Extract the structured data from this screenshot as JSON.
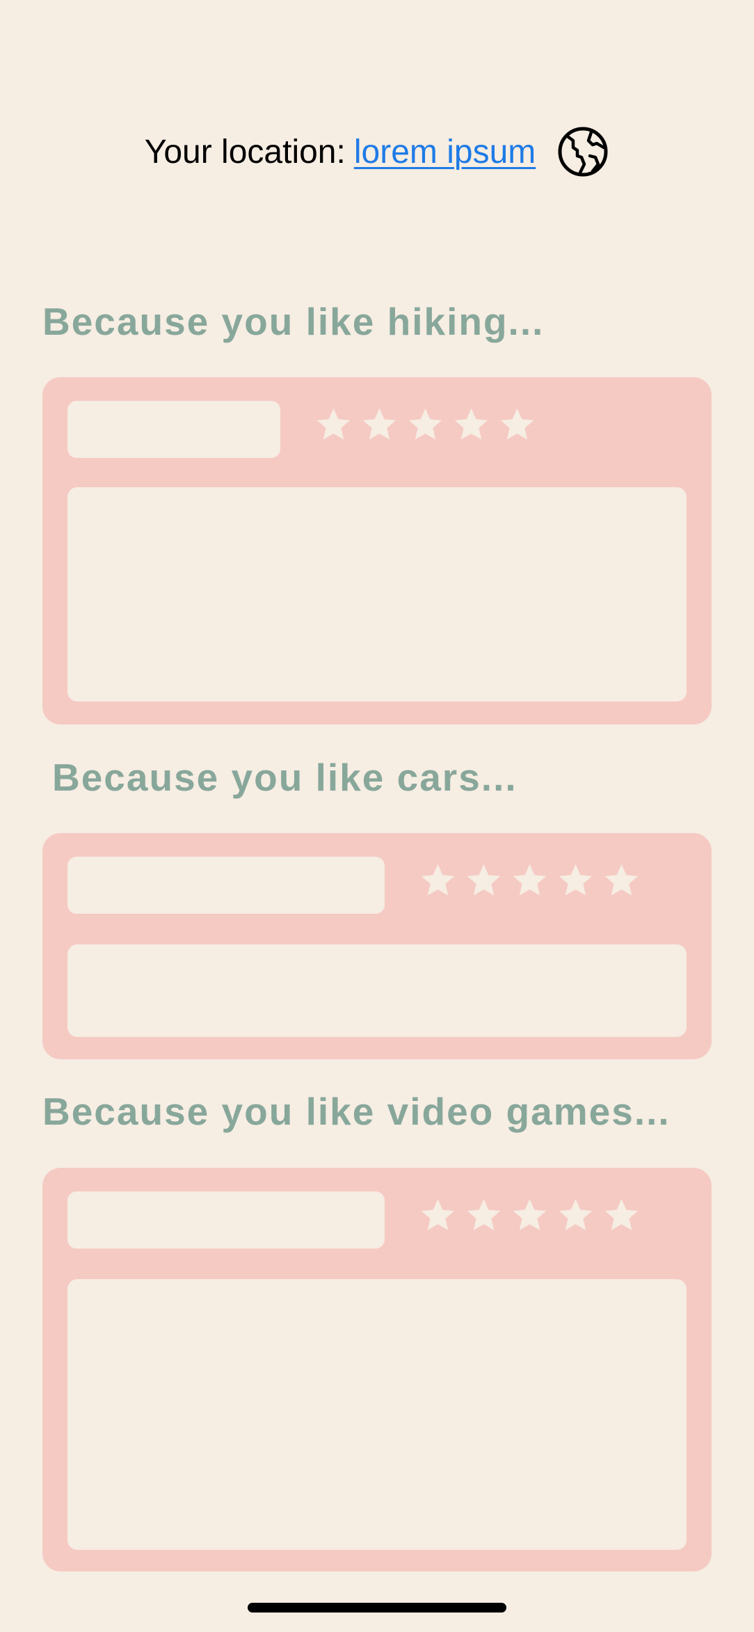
{
  "location": {
    "label": "Your location:",
    "value": "lorem ipsum",
    "icon": "globe-icon"
  },
  "sections": [
    {
      "heading": "Because you like hiking...",
      "rating": {
        "max": 5,
        "icon": "star-icon"
      }
    },
    {
      "heading": "Because you like cars...",
      "rating": {
        "max": 5,
        "icon": "star-icon"
      }
    },
    {
      "heading": "Because you like video games...",
      "rating": {
        "max": 5,
        "icon": "star-icon"
      }
    }
  ],
  "colors": {
    "background": "#f6ede3",
    "card": "#f5cac3",
    "heading": "#88a79b",
    "link": "#1e7be6",
    "star": "#f6ede3"
  }
}
